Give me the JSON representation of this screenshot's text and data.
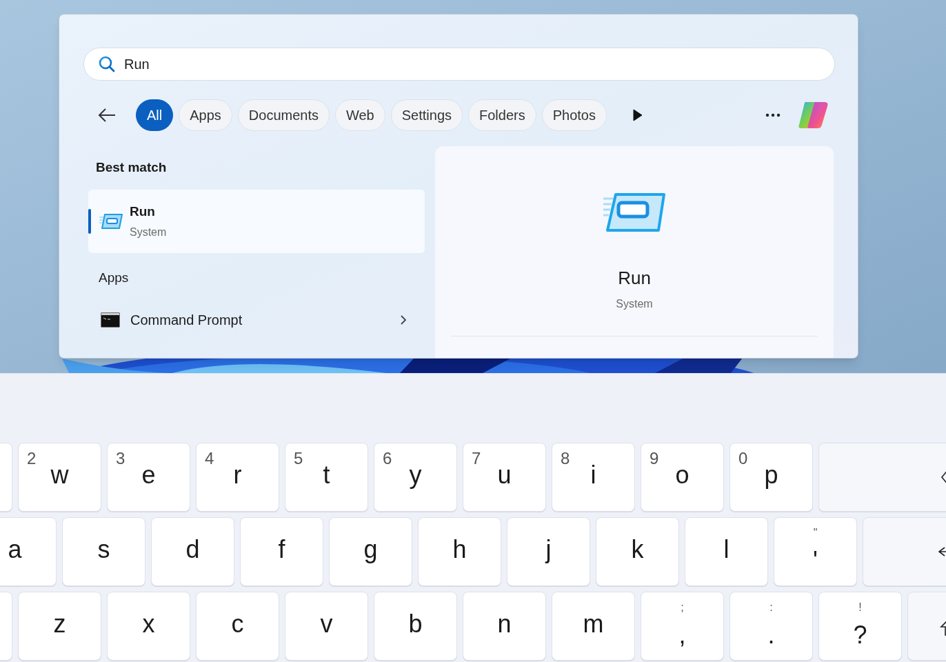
{
  "search": {
    "value": "Run"
  },
  "filters": [
    {
      "label": "All",
      "selected": true
    },
    {
      "label": "Apps",
      "selected": false
    },
    {
      "label": "Documents",
      "selected": false
    },
    {
      "label": "Web",
      "selected": false
    },
    {
      "label": "Settings",
      "selected": false
    },
    {
      "label": "Folders",
      "selected": false
    },
    {
      "label": "Photos",
      "selected": false
    }
  ],
  "best_match": {
    "heading": "Best match",
    "item": {
      "title": "Run",
      "subtitle": "System",
      "selected": true
    }
  },
  "apps": {
    "heading": "Apps",
    "items": [
      {
        "title": "Command Prompt"
      }
    ]
  },
  "preview": {
    "title": "Run",
    "subtitle": "System"
  },
  "keyboard": {
    "rows": [
      {
        "keys": [
          {
            "kind": "edge"
          },
          {
            "kind": "char",
            "label": "w",
            "secondary": "2"
          },
          {
            "kind": "char",
            "label": "e",
            "secondary": "3"
          },
          {
            "kind": "char",
            "label": "r",
            "secondary": "4"
          },
          {
            "kind": "char",
            "label": "t",
            "secondary": "5"
          },
          {
            "kind": "char",
            "label": "y",
            "secondary": "6"
          },
          {
            "kind": "char",
            "label": "u",
            "secondary": "7"
          },
          {
            "kind": "char",
            "label": "i",
            "secondary": "8"
          },
          {
            "kind": "char",
            "label": "o",
            "secondary": "9"
          },
          {
            "kind": "char",
            "label": "p",
            "secondary": "0"
          },
          {
            "kind": "backspace"
          }
        ]
      },
      {
        "keys": [
          {
            "kind": "char",
            "label": "a"
          },
          {
            "kind": "char",
            "label": "s"
          },
          {
            "kind": "char",
            "label": "d"
          },
          {
            "kind": "char",
            "label": "f"
          },
          {
            "kind": "char",
            "label": "g"
          },
          {
            "kind": "char",
            "label": "h"
          },
          {
            "kind": "char",
            "label": "j"
          },
          {
            "kind": "char",
            "label": "k"
          },
          {
            "kind": "char",
            "label": "l"
          },
          {
            "kind": "punct",
            "label": "'",
            "secondary": "\""
          },
          {
            "kind": "enter"
          }
        ]
      },
      {
        "keys": [
          {
            "kind": "edge"
          },
          {
            "kind": "char",
            "label": "z"
          },
          {
            "kind": "char",
            "label": "x"
          },
          {
            "kind": "char",
            "label": "c"
          },
          {
            "kind": "char",
            "label": "v"
          },
          {
            "kind": "char",
            "label": "b"
          },
          {
            "kind": "char",
            "label": "n"
          },
          {
            "kind": "char",
            "label": "m"
          },
          {
            "kind": "punct",
            "label": ",",
            "secondary": ";"
          },
          {
            "kind": "punct",
            "label": ".",
            "secondary": ":"
          },
          {
            "kind": "punct",
            "label": "?",
            "secondary": "!"
          },
          {
            "kind": "shift"
          }
        ]
      }
    ]
  }
}
